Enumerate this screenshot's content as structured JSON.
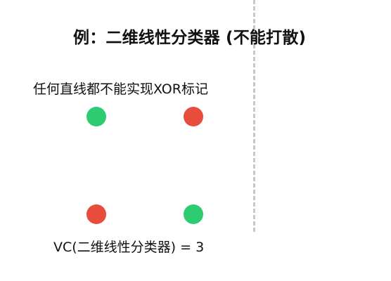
{
  "title": "例：二维线性分类器 (不能打散)",
  "subtitle": "任何直线都不能实现XOR标记",
  "footer": "VC(二维线性分类器) = 3",
  "colors": {
    "positive": "#2ecc71",
    "negative": "#e74c3c",
    "divider": "#c8c8c8",
    "text": "#111111"
  },
  "points": [
    {
      "label": "positive",
      "color": "#2ecc71"
    },
    {
      "label": "negative",
      "color": "#e74c3c"
    },
    {
      "label": "negative",
      "color": "#e74c3c"
    },
    {
      "label": "positive",
      "color": "#2ecc71"
    }
  ]
}
